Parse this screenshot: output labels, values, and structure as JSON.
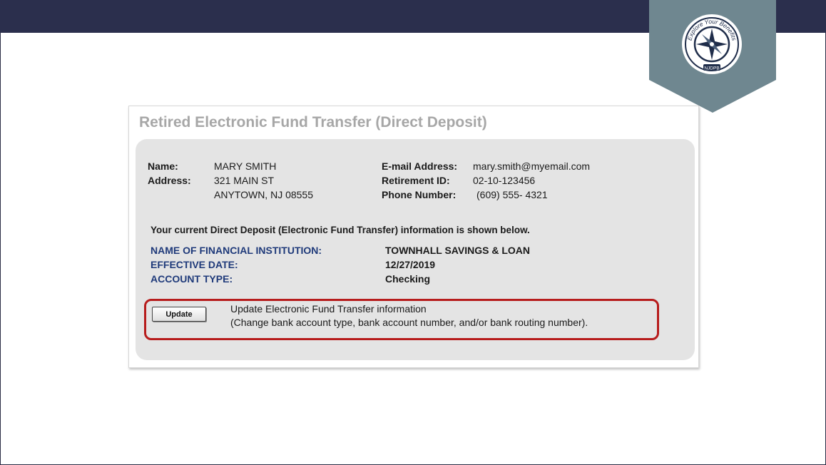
{
  "badge": {
    "logo_text": "Explore Your Benefits",
    "logo_subtext": "NJDPB"
  },
  "card": {
    "title": "Retired Electronic Fund Transfer (Direct Deposit)"
  },
  "member": {
    "name_label": "Name:",
    "name_value": "MARY SMITH",
    "address_label": "Address:",
    "address_line1": "321 MAIN ST",
    "address_line2": "ANYTOWN, NJ 08555",
    "email_label": "E-mail Address:",
    "email_value": "mary.smith@myemail.com",
    "retirement_id_label": "Retirement ID:",
    "retirement_id_value": "02-10-123456",
    "phone_label": "Phone Number:",
    "phone_value": "(609)  555- 4321"
  },
  "deposit": {
    "note": "Your current Direct Deposit (Electronic Fund Transfer) information is shown below.",
    "institution_label": "NAME OF FINANCIAL INSTITUTION:",
    "institution_value": "TOWNHALL SAVINGS & LOAN",
    "effective_label": "EFFECTIVE DATE:",
    "effective_value": "12/27/2019",
    "account_type_label": "ACCOUNT TYPE:",
    "account_type_value": "Checking"
  },
  "action": {
    "button_label": "Update",
    "line1": "Update Electronic Fund Transfer information",
    "line2": "(Change bank account type, bank account number, and/or bank routing number)."
  },
  "colors": {
    "top_bar": "#2b2f4d",
    "badge": "#6f8790",
    "card_title": "#a7a7a7",
    "label_blue": "#1f3a7a",
    "highlight_red": "#b71c1c",
    "panel_bg": "#e4e4e4"
  },
  "icons": [
    "compass-icon"
  ]
}
